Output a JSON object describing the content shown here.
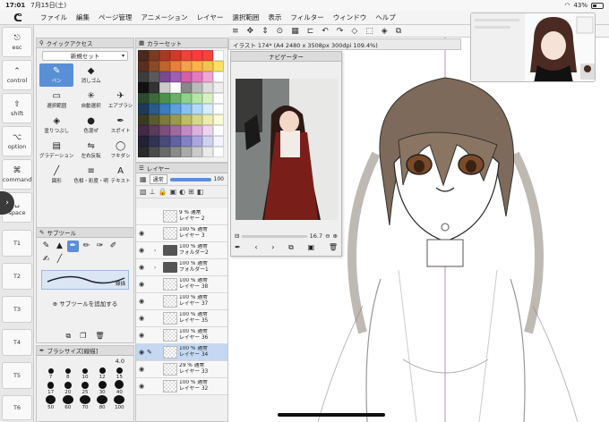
{
  "status_bar": {
    "time": "17:01",
    "date": "7月15日(土)",
    "battery": "43%",
    "battery_level": 0.43
  },
  "menu_bar": {
    "items": [
      "ファイル",
      "編集",
      "ページ管理",
      "アニメーション",
      "レイヤー",
      "選択範囲",
      "表示",
      "フィルター",
      "ウィンドウ",
      "ヘルプ"
    ]
  },
  "left_keys": [
    {
      "label": "esc",
      "icon": "esc-key-icon"
    },
    {
      "label": "control",
      "icon": "control-key-icon"
    },
    {
      "label": "shift",
      "icon": "shift-key-icon"
    },
    {
      "label": "option",
      "icon": "option-key-icon"
    },
    {
      "label": "command",
      "icon": "command-key-icon"
    },
    {
      "label": "space",
      "icon": "space-key-icon"
    },
    {
      "label": "T1",
      "icon": ""
    },
    {
      "label": "T2",
      "icon": ""
    },
    {
      "label": "T3",
      "icon": ""
    },
    {
      "label": "T4",
      "icon": ""
    },
    {
      "label": "T5",
      "icon": ""
    },
    {
      "label": "T6",
      "icon": ""
    }
  ],
  "quick_access": {
    "title": "クイックアクセス",
    "set_name": "新規セット",
    "items": [
      {
        "label": "ペン",
        "glyph": "✎",
        "active": true
      },
      {
        "label": "消しゴム",
        "glyph": "◆",
        "active": false
      },
      {
        "label": "",
        "glyph": "",
        "active": false
      },
      {
        "label": "選択範囲",
        "glyph": "▭",
        "active": false
      },
      {
        "label": "自動選択",
        "glyph": "✳",
        "active": false
      },
      {
        "label": "エアブラシ",
        "glyph": "✈",
        "active": false
      },
      {
        "label": "塗りつぶし",
        "glyph": "◈",
        "active": false
      },
      {
        "label": "色混ぜ",
        "glyph": "●",
        "active": false
      },
      {
        "label": "スポイト",
        "glyph": "✒",
        "active": false
      },
      {
        "label": "グラデーション",
        "glyph": "▤",
        "active": false
      },
      {
        "label": "左右反転",
        "glyph": "⇋",
        "active": false
      },
      {
        "label": "フキダシ",
        "glyph": "◯",
        "active": false
      },
      {
        "label": "図形",
        "glyph": "╱",
        "active": false
      },
      {
        "label": "色相・彩度・明",
        "glyph": "≡",
        "active": false
      },
      {
        "label": "テキスト",
        "glyph": "A",
        "active": false
      }
    ]
  },
  "color_set": {
    "title": "カラーセット",
    "colors": [
      "#4a2a1e",
      "#7a3b22",
      "#a83a24",
      "#d13a2a",
      "#e8463a",
      "#ff3b3b",
      "#f7423c",
      "#ffffff",
      "#5c2e20",
      "#8a4a2a",
      "#c0642e",
      "#e9803a",
      "#f2a24a",
      "#ffb347",
      "#f3c34e",
      "#ffe066",
      "#3d3d3d",
      "#5a5a5a",
      "#7a4b8c",
      "#a05fb4",
      "#d25fa8",
      "#e37bc0",
      "#f2a6d4",
      "#ffffff",
      "#111111",
      "#333333",
      "#cccccc",
      "#ffffff",
      "#888888",
      "#bbbbbb",
      "#dddddd",
      "#eeeeee",
      "#2e4a2e",
      "#3c6a3c",
      "#4e8f4a",
      "#6ab06a",
      "#8fd08a",
      "#b4e6a6",
      "#d9f2c4",
      "#ffffff",
      "#1e3a5a",
      "#2a5a8a",
      "#3b7bc0",
      "#5fa0e0",
      "#88c0f0",
      "#b0d8f8",
      "#d8ecfc",
      "#ffffff",
      "#3a3a22",
      "#5a5a32",
      "#7a7a3e",
      "#9a9a50",
      "#bcbc6a",
      "#d8d88a",
      "#ececb0",
      "#fafad8",
      "#442a44",
      "#5c3a5c",
      "#7e4e7e",
      "#a06aa0",
      "#c48ac4",
      "#ddb0dd",
      "#efd4ef",
      "#ffffff",
      "#222233",
      "#333355",
      "#4a4a7a",
      "#6262a0",
      "#8282c4",
      "#a8a8dd",
      "#d0d0f0",
      "#f4f4ff",
      "#2a2a2a",
      "#4a4a4a",
      "#6a6a6a",
      "#8a8a8a",
      "#aaaaaa",
      "#cacaca",
      "#eaeaea",
      "#ffffff"
    ]
  },
  "layer_panel": {
    "title": "レイヤー",
    "blend_mode": "通常",
    "opacity": "100",
    "opacity_fraction": 1.0,
    "rows": [
      {
        "percent": "9 %  通常",
        "name": "レイヤー 2",
        "type": "layer",
        "visible": false,
        "selected": false
      },
      {
        "percent": "100 %  通常",
        "name": "レイヤー 3",
        "type": "layer",
        "visible": true,
        "selected": false
      },
      {
        "percent": "100 %  通常",
        "name": "フォルダー2",
        "type": "folder",
        "visible": true,
        "selected": false
      },
      {
        "percent": "100 %  通常",
        "name": "フォルダー1",
        "type": "folder",
        "visible": true,
        "selected": false
      },
      {
        "percent": "100 %  通常",
        "name": "レイヤー 38",
        "type": "layer",
        "visible": true,
        "selected": false
      },
      {
        "percent": "100 %  通常",
        "name": "レイヤー 37",
        "type": "layer",
        "visible": true,
        "selected": false
      },
      {
        "percent": "100 %  通常",
        "name": "レイヤー 35",
        "type": "layer",
        "visible": true,
        "selected": false
      },
      {
        "percent": "100 %  通常",
        "name": "レイヤー 36",
        "type": "layer",
        "visible": true,
        "selected": false
      },
      {
        "percent": "100 %  通常",
        "name": "レイヤー 34",
        "type": "layer",
        "visible": true,
        "selected": true
      },
      {
        "percent": "29 %  通常",
        "name": "レイヤー 33",
        "type": "layer",
        "visible": true,
        "selected": false
      },
      {
        "percent": "100 %  通常",
        "name": "レイヤー 32",
        "type": "layer",
        "visible": true,
        "selected": false
      }
    ]
  },
  "sub_tool": {
    "title": "サブツール",
    "stroke_caption": "線描",
    "add_label": "サブツールを追加する"
  },
  "brush_size": {
    "title": "ブラシサイズ[線描]",
    "current": "4.0",
    "sizes": [
      "7",
      "8",
      "10",
      "12",
      "15",
      "17",
      "20",
      "25",
      "30",
      "40",
      "50",
      "60",
      "70",
      "80",
      "100"
    ]
  },
  "document": {
    "tab_label": "イラスト 174* (A4 2480 x 3508px 300dpi 109.4%)"
  },
  "navigator": {
    "title": "ナビゲーター",
    "zoom": "16.7"
  },
  "colors": {
    "accent": "#5a8fd6",
    "panel_bg": "#f0f0f0"
  }
}
